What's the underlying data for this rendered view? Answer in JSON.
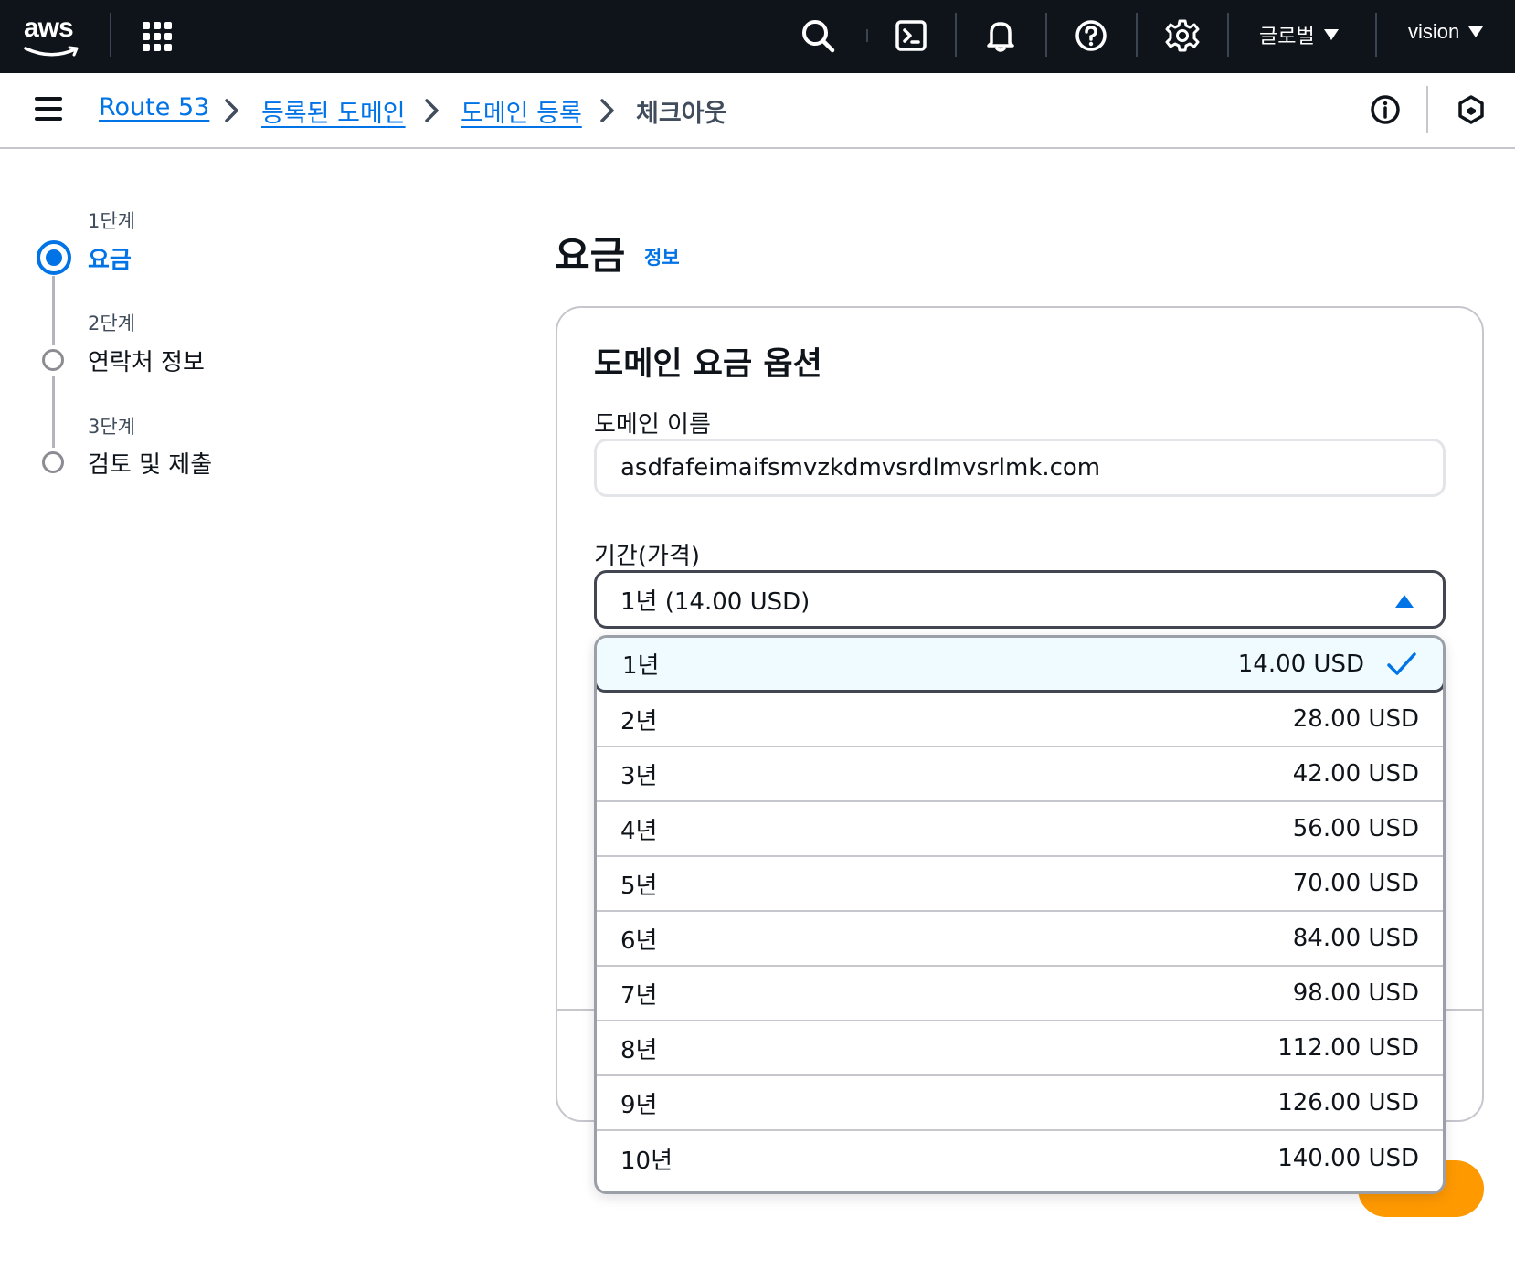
{
  "topbar": {
    "logo_text": "aws",
    "region_label": "글로벌",
    "account_label": "vision",
    "icons": [
      "apps-grid-icon",
      "search-icon",
      "cloudshell-icon",
      "notifications-bell-icon",
      "help-icon",
      "settings-gear-icon"
    ]
  },
  "breadcrumb": {
    "items": [
      "Route 53",
      "등록된 도메인",
      "도메인 등록"
    ],
    "current": "체크아웃"
  },
  "wizard": {
    "steps": [
      {
        "label": "1단계",
        "title": "요금"
      },
      {
        "label": "2단계",
        "title": "연락처 정보"
      },
      {
        "label": "3단계",
        "title": "검토 및 제출"
      }
    ]
  },
  "main": {
    "title": "요금",
    "info_link": "정보"
  },
  "card": {
    "title": "도메인 요금 옵션",
    "domain_label": "도메인 이름",
    "domain_value": "asdfafeimaifsmvzkdmvsrdlmvsrlmk.com",
    "period_label": "기간(가격)",
    "period_selected": "1년 (14.00 USD)"
  },
  "dropdown": {
    "options": [
      {
        "label": "1년",
        "price": "14.00 USD"
      },
      {
        "label": "2년",
        "price": "28.00 USD"
      },
      {
        "label": "3년",
        "price": "42.00 USD"
      },
      {
        "label": "4년",
        "price": "56.00 USD"
      },
      {
        "label": "5년",
        "price": "70.00 USD"
      },
      {
        "label": "6년",
        "price": "84.00 USD"
      },
      {
        "label": "7년",
        "price": "98.00 USD"
      },
      {
        "label": "8년",
        "price": "112.00 USD"
      },
      {
        "label": "9년",
        "price": "126.00 USD"
      },
      {
        "label": "10년",
        "price": "140.00 USD"
      }
    ]
  },
  "colors": {
    "accent": "#0073e6",
    "topbar_bg": "#0f141a",
    "primary_button": "#ff9900",
    "selected_option_bg": "#f0fbff"
  }
}
